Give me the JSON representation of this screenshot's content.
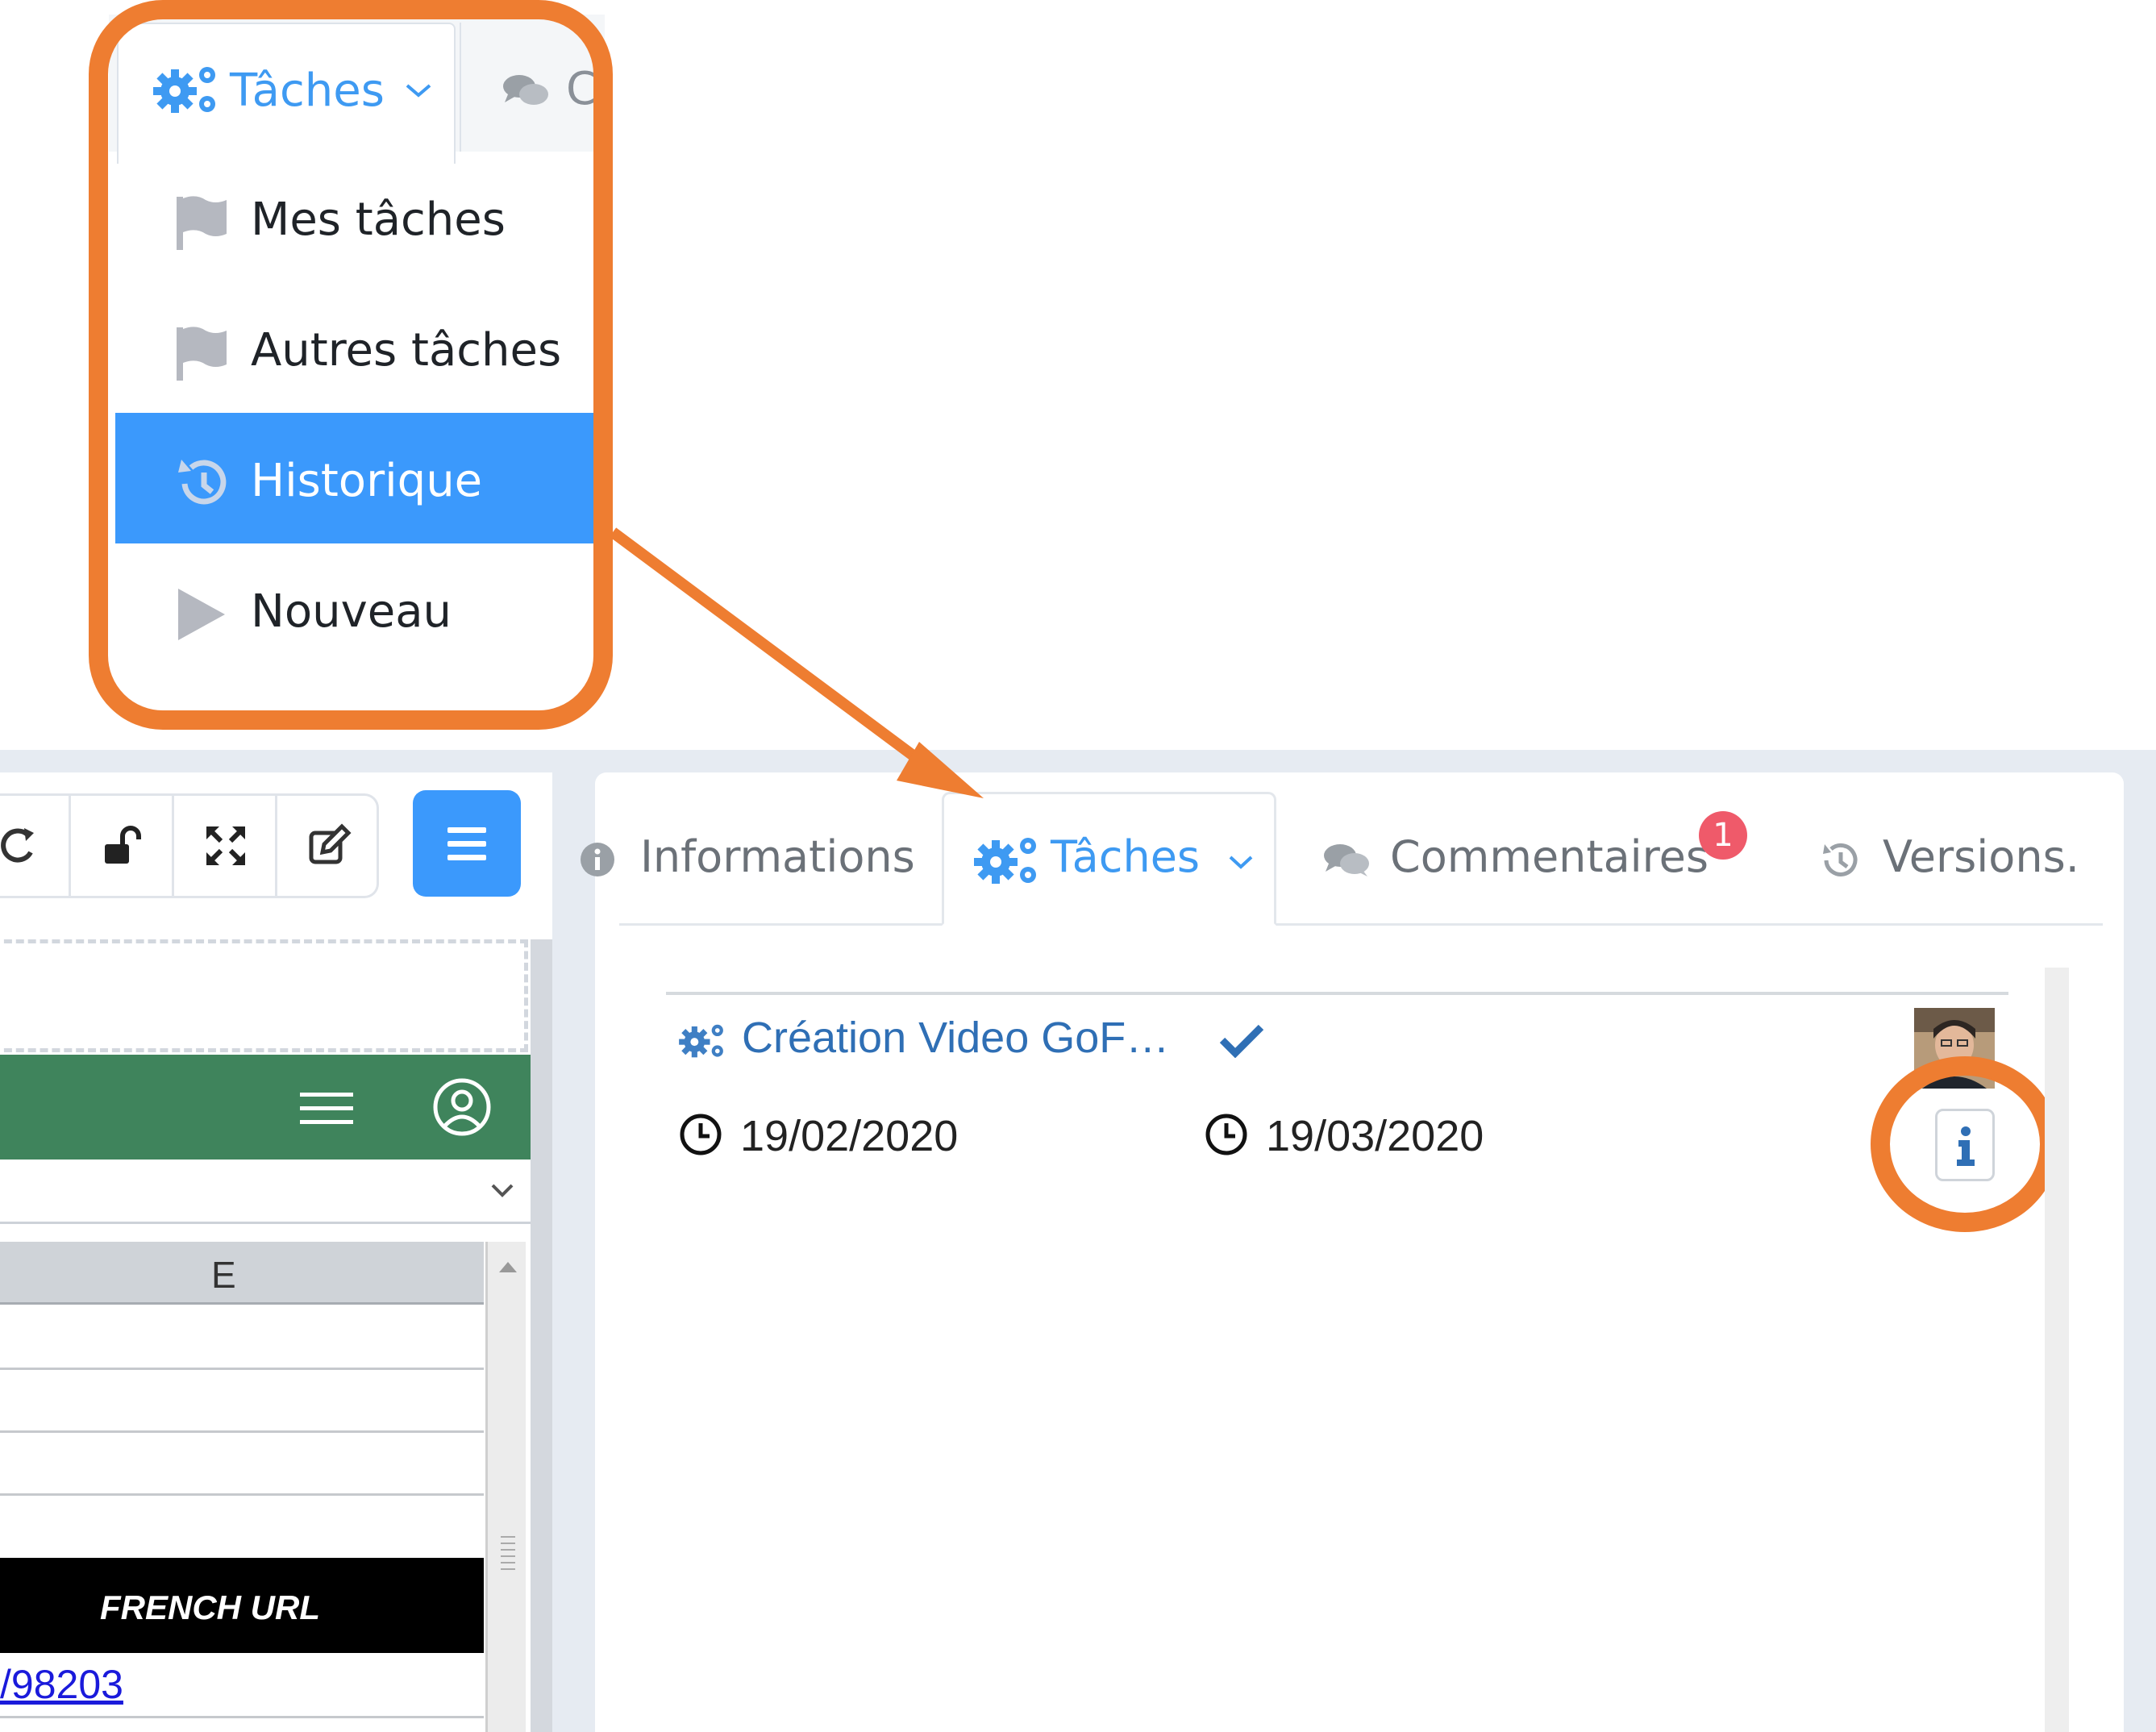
{
  "callout": {
    "tab_label": "Tâches",
    "next_tab_label": "C",
    "menu_items": [
      {
        "label": "Mes tâches",
        "icon": "flag-icon",
        "active": false
      },
      {
        "label": "Autres tâches",
        "icon": "flag-icon",
        "active": false
      },
      {
        "label": "Historique",
        "icon": "history-icon",
        "active": true
      },
      {
        "label": "Nouveau",
        "icon": "play-icon",
        "active": false
      }
    ]
  },
  "colors": {
    "callout_orange": "#ee7d31",
    "active_blue": "#3b99fc",
    "green_bar": "#3f845c",
    "badge_red": "#ef5a6a"
  },
  "left_panel": {
    "toolbar_icons": [
      "refresh-icon",
      "unlock-icon",
      "expand-icon",
      "edit-icon"
    ],
    "menu_icon": "hamburger-icon",
    "green_bar_icons": [
      "menu-icon",
      "user-circle-icon"
    ],
    "sheet": {
      "column_header": "E",
      "french_url_header": "FRENCH URL",
      "url_cell": "/98203"
    }
  },
  "right_panel": {
    "tabs": [
      {
        "label": "Informations",
        "icon": "info-circle-icon",
        "active": false
      },
      {
        "label": "Tâches",
        "icon": "gears-icon",
        "active": true
      },
      {
        "label": "Commentaires",
        "icon": "comments-icon",
        "active": false,
        "badge": "1"
      },
      {
        "label": "Versions.",
        "icon": "history-icon",
        "active": false
      }
    ],
    "task": {
      "title": "Création Video GoF…",
      "start_date": "19/02/2020",
      "end_date": "19/03/2020",
      "status_icon": "check-icon",
      "info_button_icon": "info-icon"
    }
  }
}
